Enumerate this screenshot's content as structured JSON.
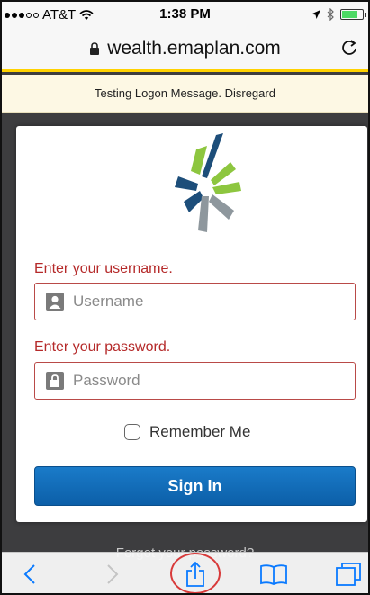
{
  "status_bar": {
    "carrier": "AT&T",
    "time": "1:38 PM"
  },
  "url_bar": {
    "url": "wealth.emaplan.com"
  },
  "message": "Testing Logon Message. Disregard",
  "login": {
    "username_label": "Enter your username.",
    "username_placeholder": "Username",
    "password_label": "Enter your password.",
    "password_placeholder": "Password",
    "remember_label": "Remember Me",
    "signin_label": "Sign In"
  },
  "forgot_link": "Forgot your password?",
  "colors": {
    "accent_yellow": "#ffd200",
    "error_red": "#b52a2a",
    "signin_blue": "#0c5fa8",
    "ios_blue": "#0a7aff",
    "logo_green": "#8dc63f",
    "logo_navy": "#1d4e7a",
    "logo_gray": "#8e979d"
  },
  "icons": {
    "share": "share-icon",
    "back": "chevron-left-icon",
    "forward": "chevron-right-icon",
    "bookmarks": "book-icon",
    "tabs": "tabs-icon",
    "lock": "lock-icon",
    "reload": "reload-icon"
  }
}
